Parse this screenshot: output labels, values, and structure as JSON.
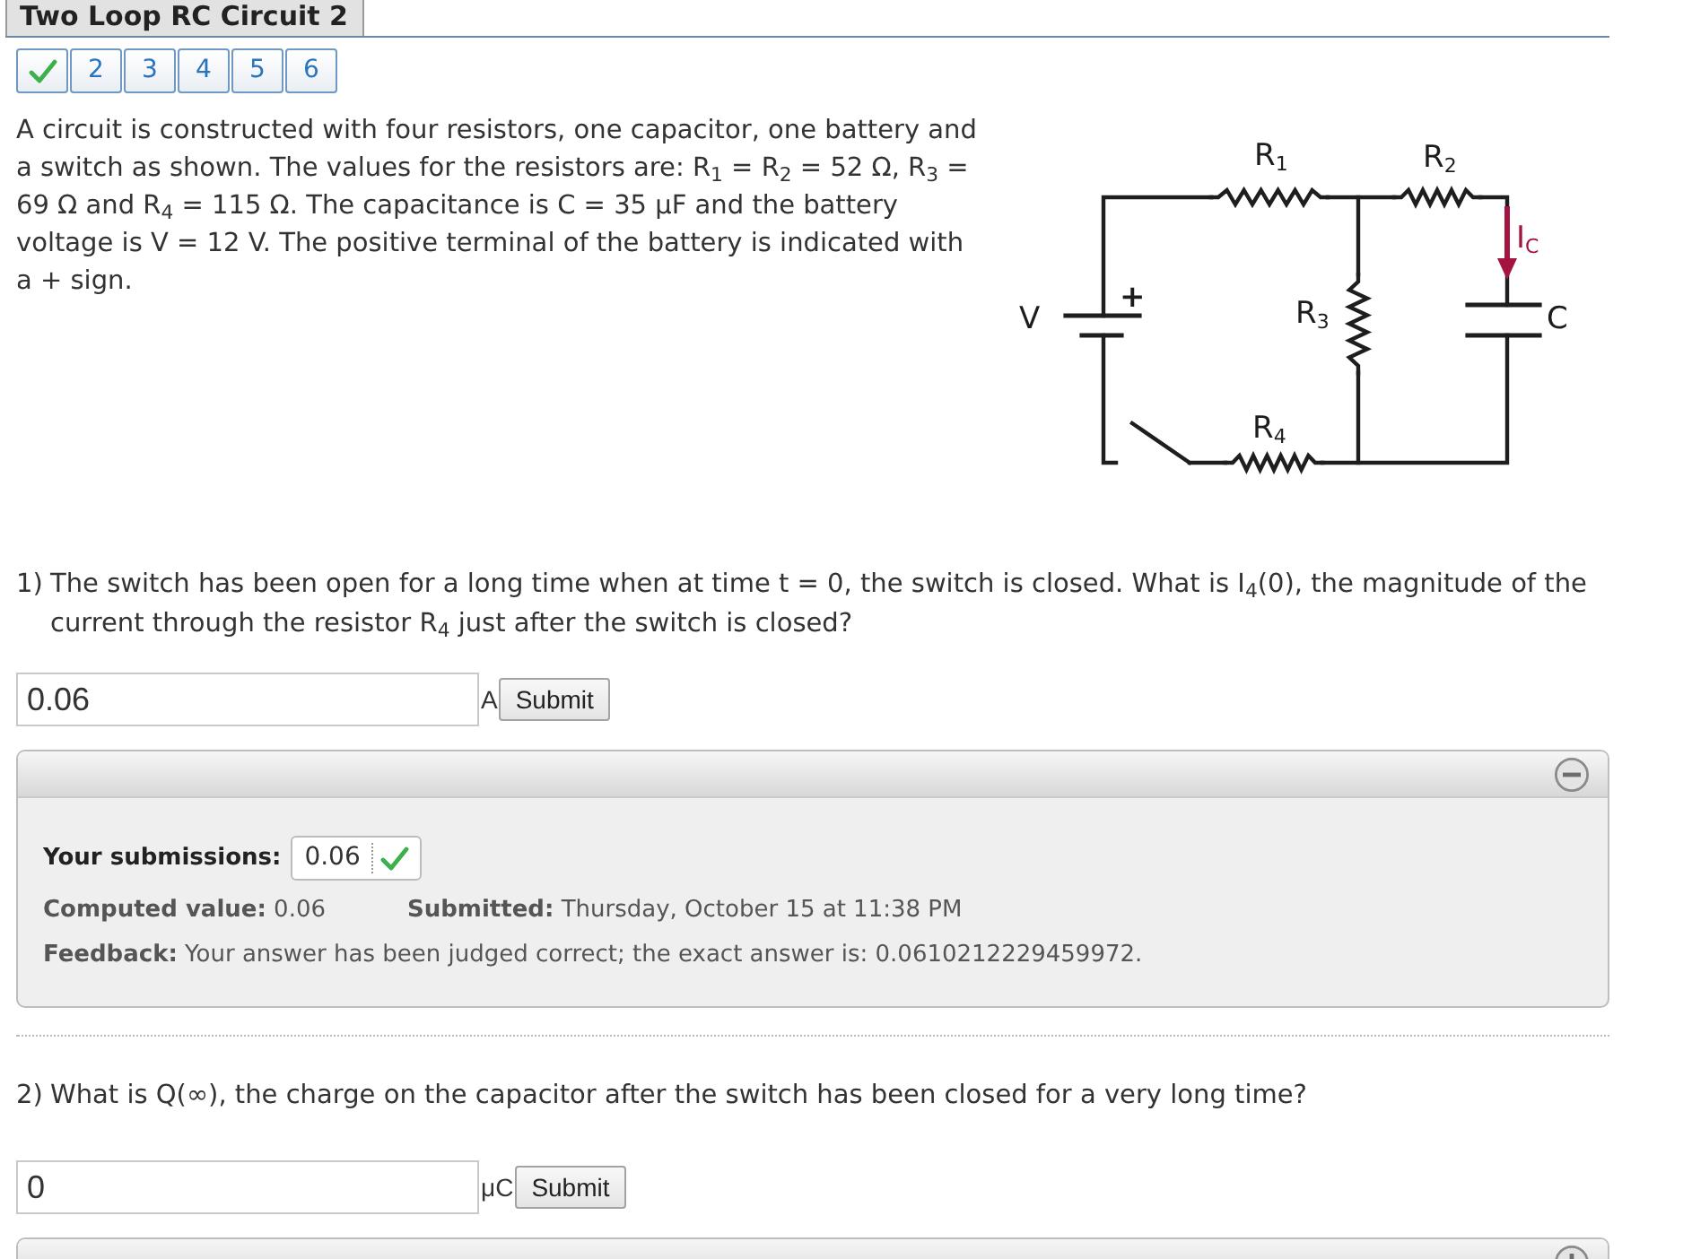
{
  "title_tab": {
    "label": "Two Loop RC Circuit 2"
  },
  "part_nav": [
    {
      "completed": true
    },
    {
      "label": "2",
      "completed": false
    },
    {
      "label": "3",
      "completed": false
    },
    {
      "label": "4",
      "completed": false
    },
    {
      "label": "5",
      "completed": false
    },
    {
      "label": "6",
      "completed": false
    }
  ],
  "intro": "A circuit is constructed with four resistors, one capacitor, one battery and a switch as shown. The values for the resistors are: R$_{1}$ = R$_{2}$ = 52 Ω, R$_{3}$ = 69 Ω and R$_{4}$ = 115 Ω. The capacitance is C = 35 μF and the battery voltage is V = 12 V. The positive terminal of the battery is indicated with a + sign.",
  "circuit": {
    "switch": {
      "closed": false
    },
    "labels": [
      {
        "text": "R$_{1}$"
      },
      {
        "text": "R$_{2}$"
      },
      {
        "text": "I$_{C}$",
        "color": "#a3153f"
      },
      {
        "text": "+"
      },
      {
        "text": "V"
      },
      {
        "text": "R$_{3}$"
      },
      {
        "text": "C"
      },
      {
        "text": "R$_{4}$"
      }
    ]
  },
  "questions": [
    {
      "number": "1)",
      "text": "The switch has been open for a long time when at time t = 0, the switch is closed. What is I$_{4}$(0), the magnitude of the current through the resistor R$_{4}$ just after the switch is closed?",
      "answer": "0.06",
      "unit": "A",
      "submit": "Submit",
      "feedback_panel": {
        "expanded": true,
        "submissions_label": "Your submissions:",
        "submissions": [
          {
            "value": "0.06",
            "correct": true
          }
        ],
        "computed": "**Computed value:** 0.06",
        "submitted": "**Submitted:** Thursday, October 15 at 11:38 PM",
        "feedback": "**Feedback:** Your answer has been judged correct; the exact answer is: 0.0610212229459972."
      }
    },
    {
      "number": "2)",
      "text": "What is Q(∞), the charge on the capacitor after the switch has been closed for a very long time?",
      "answer": "0",
      "unit": "μC",
      "submit": "Submit",
      "feedback_panel": {
        "expanded": false
      }
    }
  ]
}
